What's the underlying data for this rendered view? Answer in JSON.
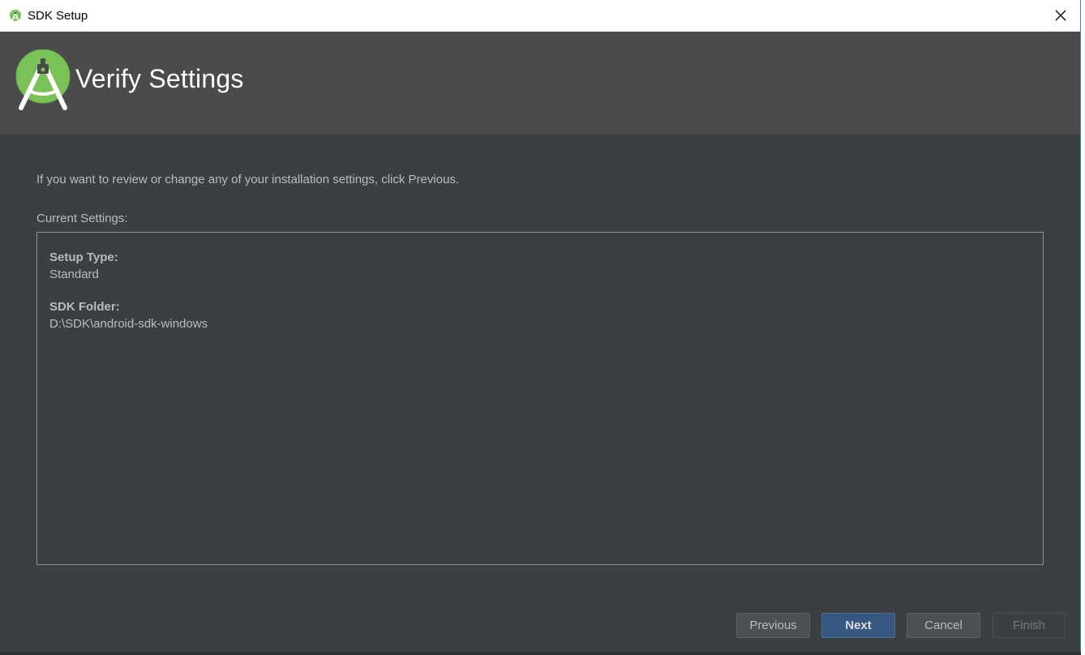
{
  "window": {
    "title": "SDK Setup"
  },
  "header": {
    "heading": "Verify Settings"
  },
  "content": {
    "intro": "If you want to review or change any of your installation settings, click Previous.",
    "current_settings_label": "Current Settings:",
    "settings": [
      {
        "key": "Setup Type:",
        "value": "Standard"
      },
      {
        "key": "SDK Folder:",
        "value": "D:\\SDK\\android-sdk-windows"
      }
    ]
  },
  "buttons": {
    "previous": "Previous",
    "next": "Next",
    "cancel": "Cancel",
    "finish": "Finish"
  },
  "colors": {
    "background": "#3c3f41",
    "header": "#4b4b4b",
    "primary_button": "#365880",
    "android_green": "#78c257"
  },
  "icons": {
    "app": "android-studio-icon",
    "close": "close-icon",
    "logo": "android-studio-logo"
  }
}
